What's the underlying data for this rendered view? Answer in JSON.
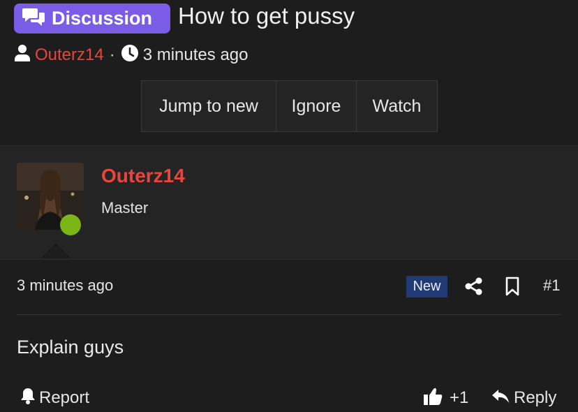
{
  "thread": {
    "prefix_label": "Discussion",
    "title": "How to get pussy",
    "author": "Outerz14",
    "separator": "·",
    "posted_ago": "3 minutes ago"
  },
  "actions": {
    "jump_to_new": "Jump to new",
    "ignore": "Ignore",
    "watch": "Watch"
  },
  "post": {
    "username": "Outerz14",
    "user_title": "Master",
    "time": "3 minutes ago",
    "new_badge": "New",
    "number": "#1",
    "body": "Explain guys",
    "report_label": "Report",
    "like_count": "+1",
    "reply_label": "Reply"
  },
  "icons": {
    "badge": "chat-bubbles-icon",
    "author": "user-icon",
    "time": "clock-icon",
    "share": "share-icon",
    "bookmark": "bookmark-icon",
    "report": "bell-icon",
    "like": "thumbs-up-icon",
    "reply": "reply-icon"
  },
  "colors": {
    "prefix_badge": "#7b5ce6",
    "username": "#e8453c",
    "online": "#7cb518",
    "new_badge": "#223a73",
    "background": "#1d1d1d"
  }
}
